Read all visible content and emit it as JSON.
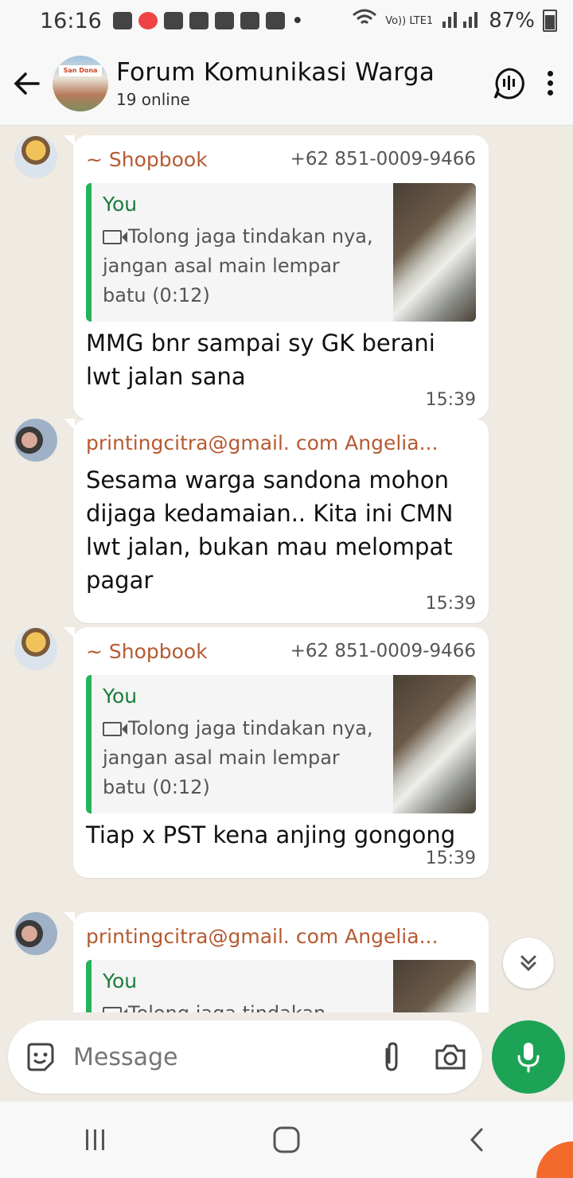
{
  "status_bar": {
    "time": "16:16",
    "network": "Vo)) LTE1",
    "battery": "87%"
  },
  "header": {
    "title": "Forum Komunikasi Warga",
    "subtitle": "19 online",
    "group_avatar_text": "San Dona"
  },
  "messages": [
    {
      "sender": "~ Shopbook",
      "phone": "+62 851-0009-9466",
      "quote": {
        "author": "You",
        "text": "Tolong jaga tindakan nya, jangan asal main lempar batu (0:12)"
      },
      "text": "MMG bnr sampai sy GK berani lwt jalan sana",
      "time": "15:39"
    },
    {
      "sender": "printingcitra@gmail. com Angelia...",
      "text": "Sesama warga sandona mohon dijaga kedamaian.. Kita ini CMN lwt jalan, bukan mau melompat pagar",
      "time": "15:39"
    },
    {
      "sender": "~ Shopbook",
      "phone": "+62 851-0009-9466",
      "quote": {
        "author": "You",
        "text": "Tolong jaga tindakan nya, jangan asal main lempar batu (0:12)"
      },
      "text": "Tiap x PST kena anjing gongong",
      "time": "15:39"
    },
    {
      "sender": "printingcitra@gmail. com Angelia...",
      "quote": {
        "author": "You",
        "text": "Tolong jaga tindakan"
      }
    }
  ],
  "input": {
    "placeholder": "Message"
  },
  "colors": {
    "accent_green": "#1da356",
    "sender_color": "#b65a32",
    "quote_bar": "#25b35b"
  }
}
